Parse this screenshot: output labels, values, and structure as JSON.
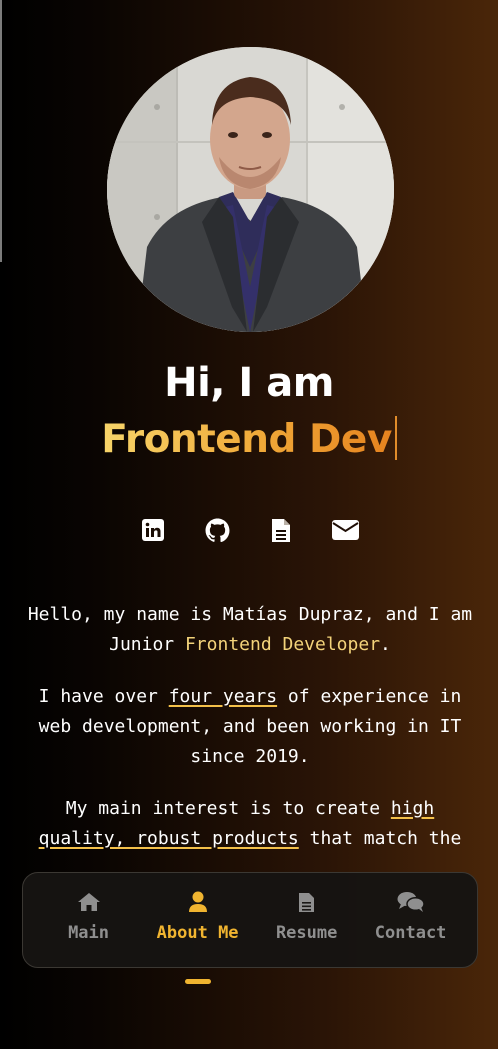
{
  "hero": {
    "greeting": "Hi, I am",
    "role": "Frontend Dev"
  },
  "socials": [
    {
      "icon": "linkedin-icon"
    },
    {
      "icon": "github-icon"
    },
    {
      "icon": "document-icon"
    },
    {
      "icon": "envelope-icon"
    }
  ],
  "bio": {
    "p1_before": "Hello, my name is Matías Dupraz, and I am Junior ",
    "p1_highlight": "Frontend Developer",
    "p1_after": ".",
    "p2_before": "I have over ",
    "p2_underline": "four years",
    "p2_after": " of experience in web development, and been working in IT since 2019.",
    "p3_before": "My main interest is to create ",
    "p3_underline": "high quality, robust products",
    "p3_after": " that match the"
  },
  "nav": {
    "items": [
      {
        "label": "Main",
        "icon": "home-icon"
      },
      {
        "label": "About Me",
        "icon": "user-icon"
      },
      {
        "label": "Resume",
        "icon": "file-icon"
      },
      {
        "label": "Contact",
        "icon": "comments-icon"
      }
    ],
    "active": "About Me"
  },
  "colors": {
    "accent": "#f0b430",
    "gradient_start": "#f7d56a",
    "gradient_end": "#e5831f",
    "nav_inactive": "#8f8f8f"
  }
}
